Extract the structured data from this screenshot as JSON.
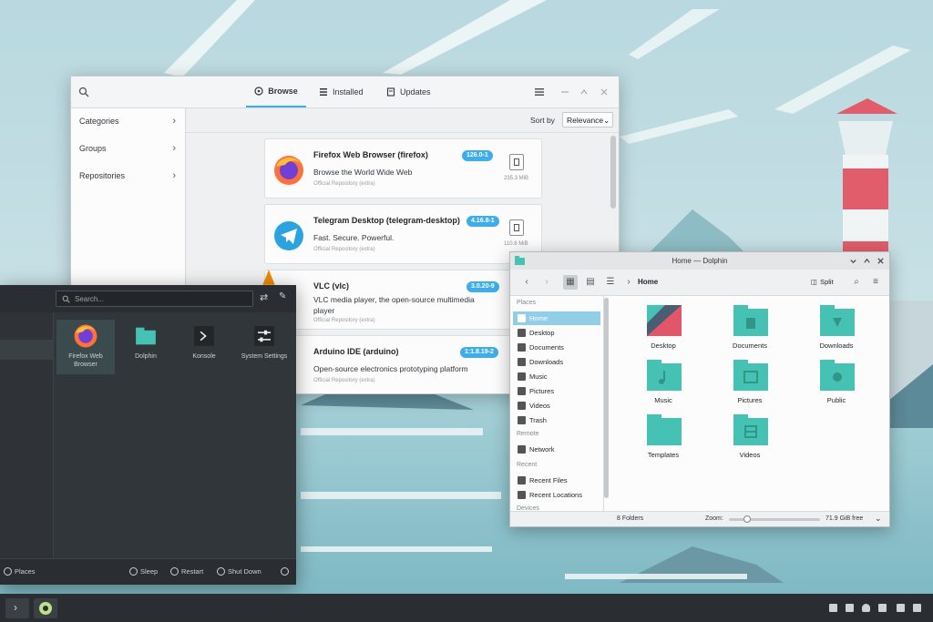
{
  "discover": {
    "tabs": [
      "Browse",
      "Installed",
      "Updates"
    ],
    "sidebar": [
      "Categories",
      "Groups",
      "Repositories"
    ],
    "sort_label": "Sort by",
    "sort_value": "Relevance",
    "apps": [
      {
        "name": "Firefox Web Browser (firefox)",
        "desc": "Browse the World Wide Web",
        "source": "Official Repository (extra)",
        "version": "126.0-1",
        "size": "235.3 MiB"
      },
      {
        "name": "Telegram Desktop (telegram-desktop)",
        "desc": "Fast. Secure. Powerful.",
        "source": "Official Repository (extra)",
        "version": "4.16.8-1",
        "size": "110.6 MiB"
      },
      {
        "name": "VLC (vlc)",
        "desc": "VLC media player, the open-source multimedia player",
        "source": "Official Repository (extra)",
        "version": "3.0.20-9"
      },
      {
        "name": "Arduino IDE (arduino)",
        "desc": "Open-source electronics prototyping platform",
        "source": "Official Repository (extra)",
        "version": "1:1.8.19-2"
      }
    ]
  },
  "dolphin": {
    "title": "Home — Dolphin",
    "location": "Home",
    "split_label": "Split",
    "places_heading": "Places",
    "places": [
      "Home",
      "Desktop",
      "Documents",
      "Downloads",
      "Music",
      "Pictures",
      "Videos",
      "Trash"
    ],
    "remote_heading": "Remote",
    "remote": [
      "Network"
    ],
    "recent_heading": "Recent",
    "recent": [
      "Recent Files",
      "Recent Locations"
    ],
    "devices_heading": "Devices",
    "folders": [
      "Desktop",
      "Documents",
      "Downloads",
      "Music",
      "Pictures",
      "Public",
      "Templates",
      "Videos"
    ],
    "status_count": "8 Folders",
    "zoom_label": "Zoom:",
    "free_space": "71.9 GiB free"
  },
  "launcher": {
    "search_placeholder": "Search...",
    "apps": [
      {
        "label": "Firefox Web Browser"
      },
      {
        "label": "Dolphin"
      },
      {
        "label": "Konsole"
      },
      {
        "label": "System Settings"
      }
    ],
    "places_button": "Places",
    "sleep": "Sleep",
    "restart": "Restart",
    "shutdown": "Shut Down"
  },
  "colors": {
    "accent": "#3daee9",
    "folder": "#45c2b4",
    "dark_panel": "#31363b"
  }
}
